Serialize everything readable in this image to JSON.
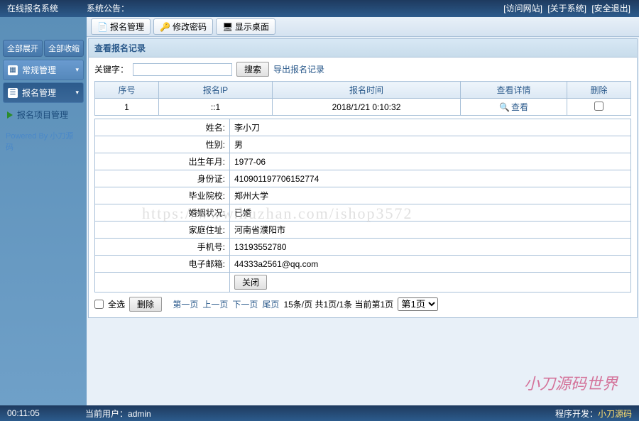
{
  "header": {
    "title": "在线报名系统",
    "announce_label": "系统公告：",
    "links": {
      "visit": "[访问网站]",
      "about": "[关于系统]",
      "logout": "[安全退出]"
    }
  },
  "toolbar": {
    "signup_mgmt": "报名管理",
    "change_pwd": "修改密码",
    "show_desktop": "显示桌面"
  },
  "sidebar": {
    "expand_all": "全部展开",
    "collapse_all": "全部收缩",
    "items": [
      {
        "label": "常规管理"
      },
      {
        "label": "报名管理"
      },
      {
        "label": "报名项目管理"
      }
    ],
    "powered_prefix": "Powered By ",
    "powered_link": "小刀源码"
  },
  "panel": {
    "title": "查看报名记录",
    "keyword_label": "关键字：",
    "search_btn": "搜索",
    "export_link": "导出报名记录"
  },
  "grid": {
    "headers": {
      "seq": "序号",
      "ip": "报名IP",
      "time": "报名时间",
      "detail": "查看详情",
      "del": "删除"
    },
    "rows": [
      {
        "seq": "1",
        "ip": "::1",
        "time": "2018/1/21 0:10:32",
        "view": "查看"
      }
    ]
  },
  "detail": {
    "name_l": "姓名:",
    "name_v": "李小刀",
    "sex_l": "性别:",
    "sex_v": "男",
    "birth_l": "出生年月:",
    "birth_v": "1977-06",
    "id_l": "身份证:",
    "id_v": "410901197706152774",
    "school_l": "毕业院校:",
    "school_v": "郑州大学",
    "marital_l": "婚姻状况:",
    "marital_v": "已婚",
    "addr_l": "家庭住址:",
    "addr_v": "河南省濮阳市",
    "mobile_l": "手机号:",
    "mobile_v": "13193552780",
    "email_l": "电子邮箱:",
    "email_v": "44333a2561@qq.com",
    "close_btn": "关闭"
  },
  "pager": {
    "select_all": "全选",
    "delete": "删除",
    "first": "第一页",
    "prev": "上一页",
    "next": "下一页",
    "last": "尾页",
    "info": "15条/页 共1页/1条 当前第1页",
    "select": "第1页"
  },
  "footer": {
    "time": "00:11:05",
    "user_label": "当前用户：",
    "user": "admin",
    "dev_label": "程序开发：",
    "dev_link": "小刀源码"
  },
  "watermark": "https://www.huzhan.com/ishop3572",
  "watermark2": "小刀源码世界"
}
